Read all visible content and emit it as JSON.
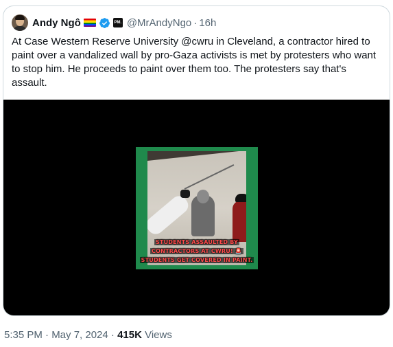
{
  "tweet": {
    "author_name": "Andy Ngô",
    "handle": "@MrAndyNgo",
    "separator": "·",
    "relative_time": "16h",
    "affiliation_badge": "PM.",
    "text": "At Case Western Reserve University @cwru in Cleveland, a contractor hired to paint over a vandalized wall by pro-Gaza activists is met by protesters who want to stop him. He proceeds to paint over them too. The protesters say that's assault.",
    "media": {
      "caption_lines": [
        "STUDENTS ASSAULTED BY",
        "CONTRACTORS AT CWRU! 🚨",
        "STUDENTS GET COVERED IN PAINT."
      ]
    }
  },
  "footer": {
    "timestamp": "5:35 PM · May 7, 2024 ·",
    "views_count": "415K",
    "views_label": "Views"
  },
  "icons": {
    "verified": "verified-badge-icon",
    "flag": "rainbow-flag-icon"
  },
  "colors": {
    "text_primary": "#0f1419",
    "text_secondary": "#536471",
    "verified_blue": "#1d9bf0",
    "border": "#cfd9de"
  }
}
